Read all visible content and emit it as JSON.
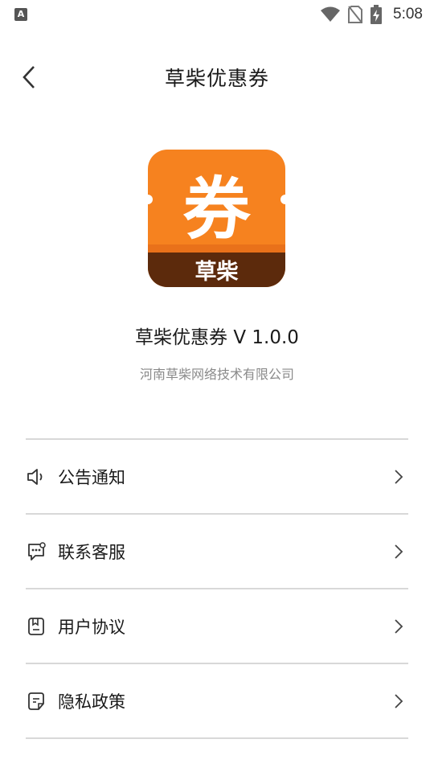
{
  "status_bar": {
    "left_badge": "A",
    "time": "5:08",
    "icons": [
      "wifi-icon",
      "no-sim-icon",
      "battery-charging-icon"
    ]
  },
  "header": {
    "title": "草柴优惠券",
    "back_icon": "chevron-left-icon"
  },
  "app": {
    "logo_glyph": "券",
    "logo_caption": "草柴",
    "logo_colors": {
      "top": "#F6821F",
      "bottom": "#5C2A0C"
    },
    "name_version": "草柴优惠券 V 1.0.0",
    "company": "河南草柴网络技术有限公司"
  },
  "menu": {
    "items": [
      {
        "label": "公告通知",
        "icon": "speaker-icon"
      },
      {
        "label": "联系客服",
        "icon": "chat-bubble-icon"
      },
      {
        "label": "用户协议",
        "icon": "document-icon"
      },
      {
        "label": "隐私政策",
        "icon": "privacy-doc-icon"
      }
    ],
    "chevron_icon": "chevron-right-icon"
  }
}
